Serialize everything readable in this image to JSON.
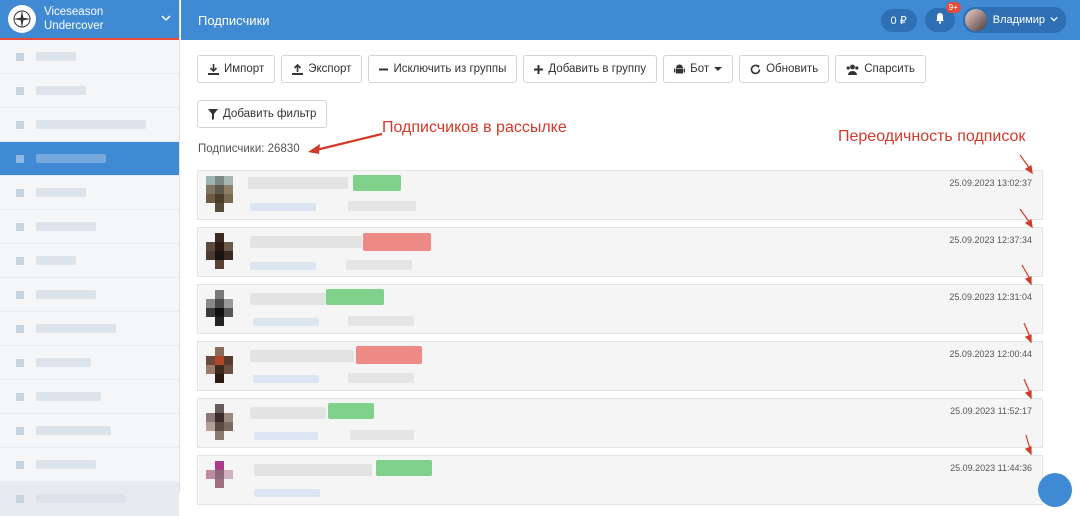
{
  "brand": {
    "line1": "Viceseason",
    "line2": "Undercover"
  },
  "header": {
    "title": "Подписчики",
    "balance": "0 ₽",
    "notifications": "9+",
    "user": "Владимир"
  },
  "toolbar": {
    "import": "Импорт",
    "export": "Экспорт",
    "exclude": "Исключить из группы",
    "add": "Добавить в группу",
    "bot": "Бот",
    "refresh": "Обновить",
    "parse": "Спарсить"
  },
  "filter": {
    "add": "Добавить фильтр"
  },
  "subscribers": {
    "count_label": "Подписчики: 26830"
  },
  "annotations": {
    "subs_in_list": "Подписчиков в рассылке",
    "periodicity": "Переодичность подписок"
  },
  "rows": [
    {
      "time": "25.09.2023 13:02:37",
      "status_color": "#7fd08a"
    },
    {
      "time": "25.09.2023 12:37:34",
      "status_color": "#ee8a86"
    },
    {
      "time": "25.09.2023 12:31:04",
      "status_color": "#7fd08a"
    },
    {
      "time": "25.09.2023 12:00:44",
      "status_color": "#ee8a86"
    },
    {
      "time": "25.09.2023 11:52:17",
      "status_color": "#7fd08a"
    },
    {
      "time": "25.09.2023 11:44:36",
      "status_color": "#7fd08a"
    }
  ],
  "colors": {
    "primary": "#3f8ad3",
    "annotation": "#d23a2a"
  }
}
